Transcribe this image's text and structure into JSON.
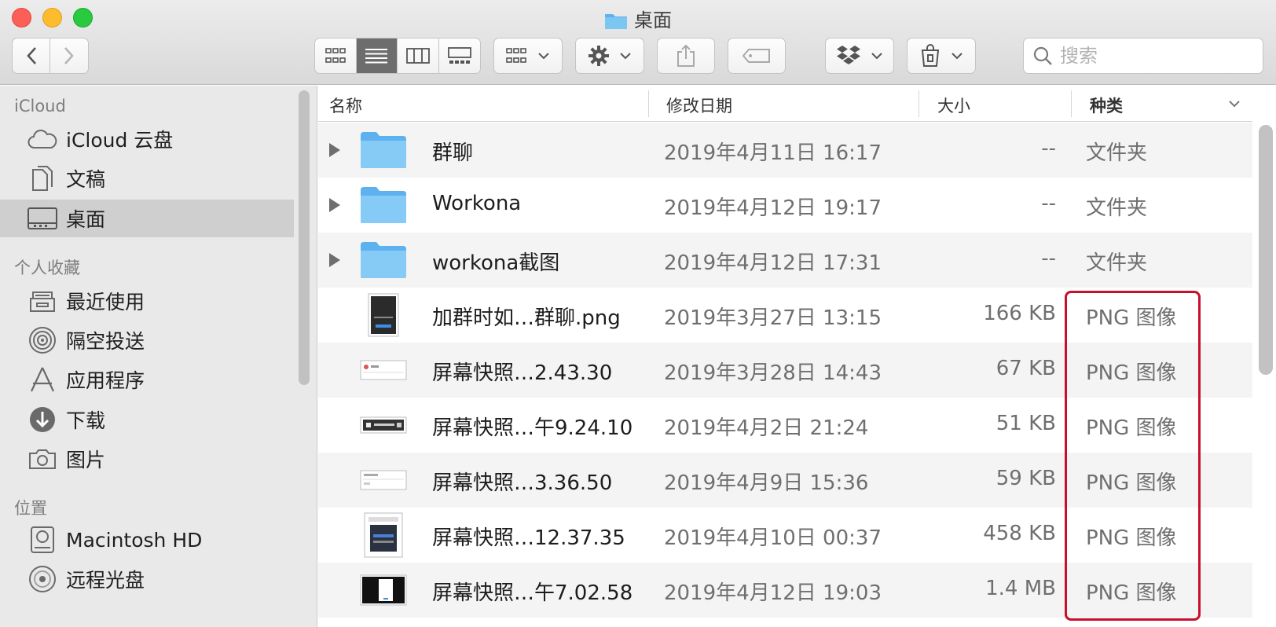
{
  "window": {
    "title": "桌面"
  },
  "toolbar": {
    "search_placeholder": "搜索",
    "view_modes": [
      "icon-view",
      "list-view",
      "column-view",
      "gallery-view"
    ],
    "active_view": "list-view"
  },
  "sidebar": {
    "sections": [
      {
        "heading": "iCloud",
        "items": [
          {
            "label": "iCloud 云盘",
            "icon": "cloud-icon"
          },
          {
            "label": "文稿",
            "icon": "document-icon"
          },
          {
            "label": "桌面",
            "icon": "desktop-icon",
            "selected": true
          }
        ]
      },
      {
        "heading": "个人收藏",
        "items": [
          {
            "label": "最近使用",
            "icon": "recents-icon"
          },
          {
            "label": "隔空投送",
            "icon": "airdrop-icon"
          },
          {
            "label": "应用程序",
            "icon": "applications-icon"
          },
          {
            "label": "下载",
            "icon": "download-icon"
          },
          {
            "label": "图片",
            "icon": "camera-icon"
          }
        ]
      },
      {
        "heading": "位置",
        "items": [
          {
            "label": "Macintosh HD",
            "icon": "harddisk-icon"
          },
          {
            "label": "远程光盘",
            "icon": "disc-icon"
          }
        ]
      }
    ]
  },
  "columns": {
    "name": "名称",
    "date": "修改日期",
    "size": "大小",
    "kind": "种类"
  },
  "files": [
    {
      "name": "群聊",
      "date": "2019年4月11日 16:17",
      "size": "--",
      "kind": "文件夹",
      "type": "folder"
    },
    {
      "name": "Workona",
      "date": "2019年4月12日 19:17",
      "size": "--",
      "kind": "文件夹",
      "type": "folder"
    },
    {
      "name": "workona截图",
      "date": "2019年4月12日 17:31",
      "size": "--",
      "kind": "文件夹",
      "type": "folder"
    },
    {
      "name": "加群时如…群聊.png",
      "date": "2019年3月27日 13:15",
      "size": "166 KB",
      "kind": "PNG 图像",
      "type": "image-portrait-dark"
    },
    {
      "name": "屏幕快照…2.43.30",
      "date": "2019年3月28日 14:43",
      "size": "67 KB",
      "kind": "PNG 图像",
      "type": "image-wide-light"
    },
    {
      "name": "屏幕快照…午9.24.10",
      "date": "2019年4月2日 21:24",
      "size": "51 KB",
      "kind": "PNG 图像",
      "type": "image-wide-dark"
    },
    {
      "name": "屏幕快照…3.36.50",
      "date": "2019年4月9日 15:36",
      "size": "59 KB",
      "kind": "PNG 图像",
      "type": "image-wide-light"
    },
    {
      "name": "屏幕快照…12.37.35",
      "date": "2019年4月10日 00:37",
      "size": "458 KB",
      "kind": "PNG 图像",
      "type": "image-square-dark"
    },
    {
      "name": "屏幕快照…午7.02.58",
      "date": "2019年4月12日 19:03",
      "size": "1.4 MB",
      "kind": "PNG 图像",
      "type": "image-wide-blackwhite"
    }
  ],
  "colors": {
    "highlight": "#c8102e",
    "selected_sidebar": "#cfcfcf",
    "folder": "#7cc6f2"
  }
}
